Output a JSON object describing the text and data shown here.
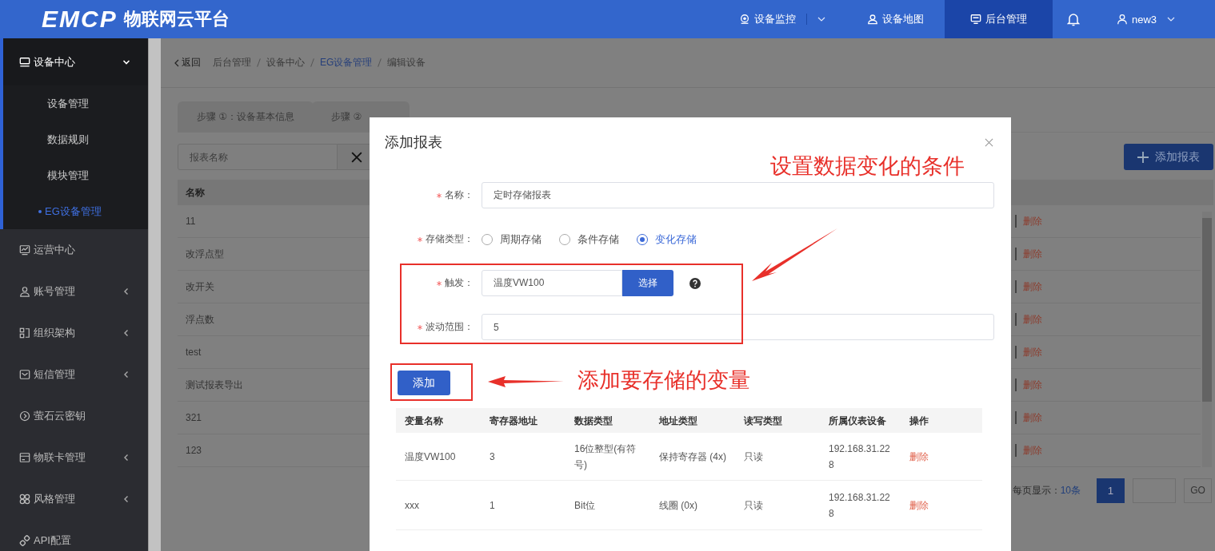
{
  "header": {
    "logo_mark": "EMCP",
    "logo_text": "物联网云平台",
    "nav": [
      {
        "label": "设备监控",
        "selected": false,
        "dropdown": true
      },
      {
        "label": "设备地图",
        "selected": false,
        "dropdown": false
      },
      {
        "label": "后台管理",
        "selected": true,
        "dropdown": false
      }
    ],
    "user": "new3"
  },
  "sidebar": {
    "items": [
      {
        "label": "设备中心",
        "kind": "group",
        "expanded": true,
        "children": [
          {
            "label": "设备管理",
            "selected": false
          },
          {
            "label": "数据规则",
            "selected": false
          },
          {
            "label": "模块管理",
            "selected": false
          },
          {
            "label": "EG设备管理",
            "selected": true
          }
        ]
      },
      {
        "label": "运营中心",
        "kind": "link"
      },
      {
        "label": "账号管理",
        "kind": "group",
        "expanded": false
      },
      {
        "label": "组织架构",
        "kind": "group",
        "expanded": false
      },
      {
        "label": "短信管理",
        "kind": "group",
        "expanded": false
      },
      {
        "label": "萤石云密钥",
        "kind": "link"
      },
      {
        "label": "物联卡管理",
        "kind": "group",
        "expanded": false
      },
      {
        "label": "风格管理",
        "kind": "group",
        "expanded": false
      },
      {
        "label": "API配置",
        "kind": "link"
      }
    ]
  },
  "breadcrumb": {
    "back": "返回",
    "items": [
      {
        "label": "后台管理",
        "link": false
      },
      {
        "label": "设备中心",
        "link": false
      },
      {
        "label": "EG设备管理",
        "link": true
      },
      {
        "label": "编辑设备",
        "link": false
      }
    ]
  },
  "tabs": [
    {
      "label": "步骤 ①：设备基本信息",
      "selected": false
    },
    {
      "label": "步骤 ②",
      "selected": false
    }
  ],
  "search": {
    "placeholder": "报表名称"
  },
  "add_report_button": "添加报表",
  "table": {
    "columns": [
      "名称"
    ],
    "rows": [
      {
        "name": "11",
        "action": "删除"
      },
      {
        "name": "改浮点型",
        "action": "删除"
      },
      {
        "name": "改开关",
        "action": "删除"
      },
      {
        "name": "浮点数",
        "action": "删除"
      },
      {
        "name": "test",
        "action": "删除"
      },
      {
        "name": "测试报表导出",
        "action": "删除"
      },
      {
        "name": "321",
        "action": "删除"
      },
      {
        "name": "123",
        "action": "删除"
      }
    ]
  },
  "pagination": {
    "label": "每页显示：",
    "page_size": "10条",
    "pages": [
      {
        "label": "1",
        "selected": true
      }
    ],
    "go": "GO"
  },
  "dialog": {
    "title": "添加报表",
    "fields": [
      {
        "kind": "text",
        "label": "名称：",
        "required": true,
        "value": "定时存储报表"
      },
      {
        "kind": "radio",
        "label": "存储类型：",
        "required": true,
        "options": [
          {
            "label": "周期存储",
            "selected": false
          },
          {
            "label": "条件存储",
            "selected": false
          },
          {
            "label": "变化存储",
            "selected": true
          }
        ]
      },
      {
        "kind": "picker",
        "label": "触发：",
        "required": true,
        "value": "温度VW100",
        "button": "选择",
        "help": true
      },
      {
        "kind": "text",
        "label": "波动范围：",
        "required": true,
        "value": "5"
      }
    ],
    "add_button": "添加",
    "variables": {
      "columns": [
        "变量名称",
        "寄存器地址",
        "数据类型",
        "地址类型",
        "读写类型",
        "所属仪表设备",
        "操作"
      ],
      "rows": [
        {
          "cells": [
            "温度VW100",
            "3",
            "16位整型(有符号)",
            "保持寄存器 (4x)",
            "只读",
            "192.168.31.228"
          ],
          "action": "删除"
        },
        {
          "cells": [
            "xxx",
            "1",
            "Bit位",
            "线圈 (0x)",
            "只读",
            "192.168.31.228"
          ],
          "action": "删除"
        }
      ]
    }
  },
  "annotations": [
    {
      "text": "设置数据变化的条件"
    },
    {
      "text": "添加要存储的变量"
    }
  ]
}
